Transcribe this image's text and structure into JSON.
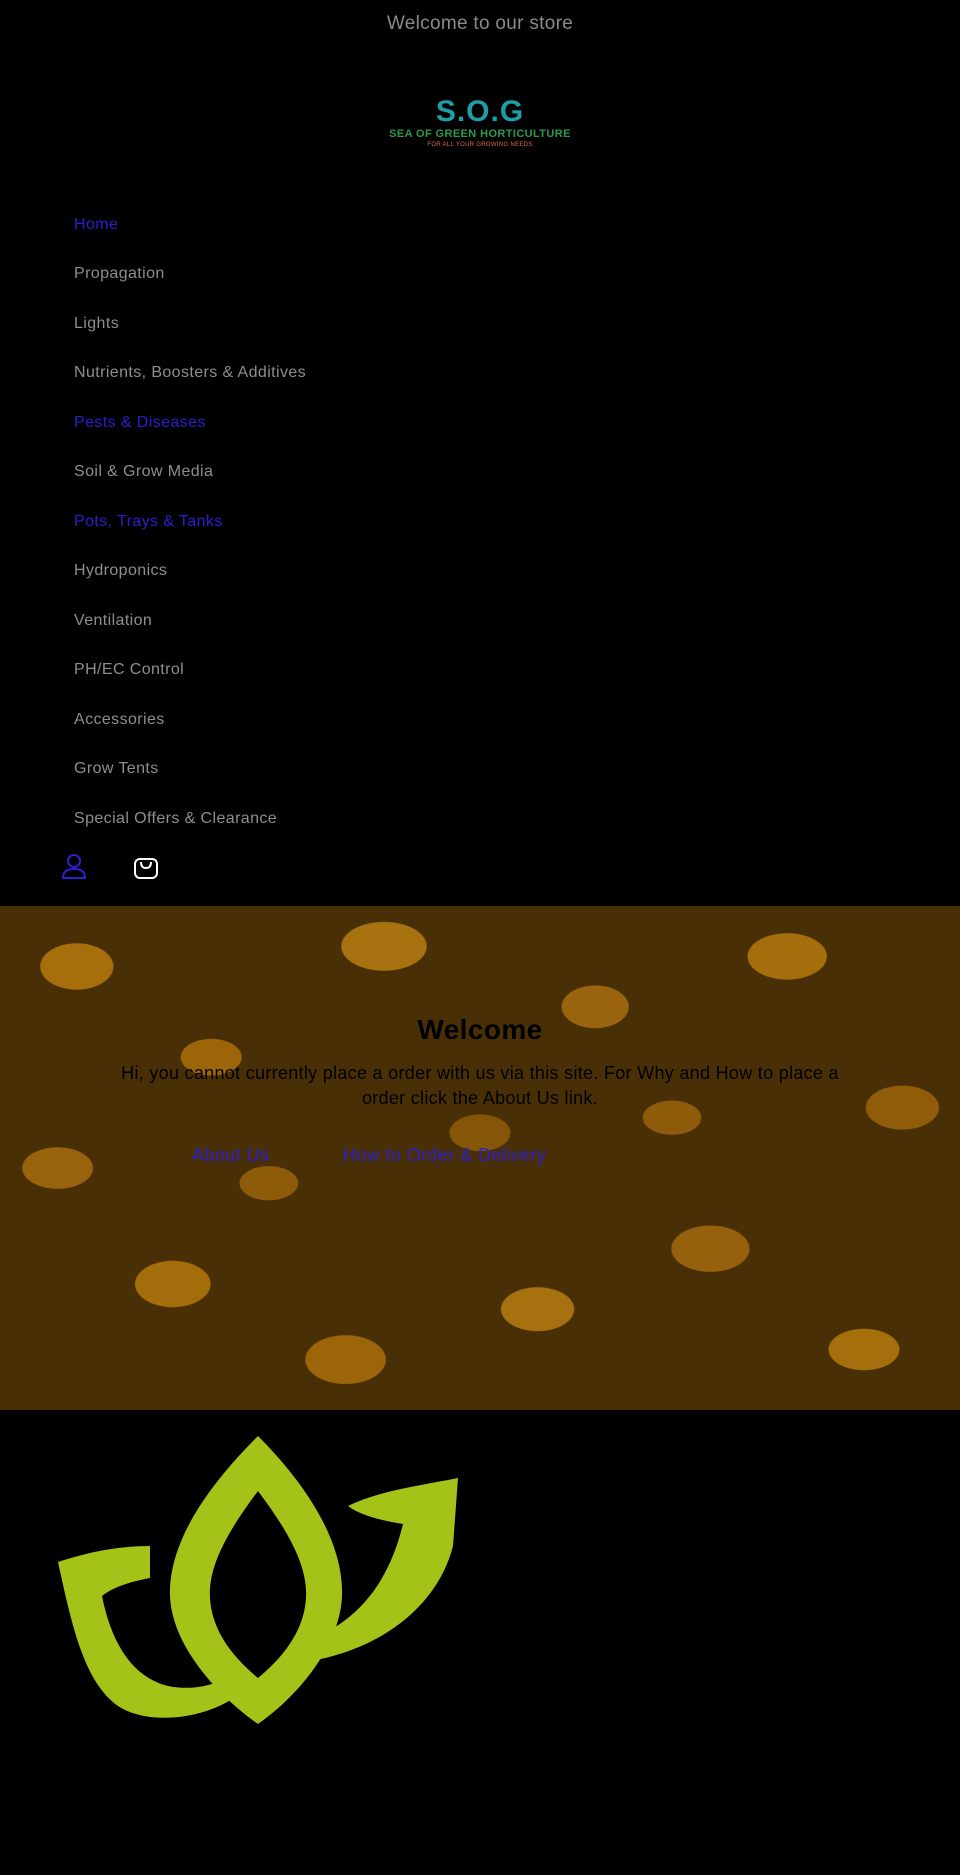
{
  "announcement": {
    "text": "Welcome to our store"
  },
  "logo": {
    "main": "S.O.G",
    "sub": "SEA OF GREEN HORTICULTURE",
    "tagline": "FOR ALL YOUR GROWING NEEDS"
  },
  "nav": {
    "items": [
      {
        "label": "Home"
      },
      {
        "label": "Propagation"
      },
      {
        "label": "Lights"
      },
      {
        "label": "Nutrients, Boosters & Additives"
      },
      {
        "label": "Pests & Diseases"
      },
      {
        "label": "Soil & Grow Media"
      },
      {
        "label": "Pots, Trays & Tanks"
      },
      {
        "label": "Hydroponics"
      },
      {
        "label": "Ventilation"
      },
      {
        "label": "PH/EC Control"
      },
      {
        "label": "Accessories"
      },
      {
        "label": "Grow Tents"
      },
      {
        "label": "Special Offers & Clearance"
      }
    ]
  },
  "icons": {
    "account": "user-icon",
    "cart": "shopping-bag-icon"
  },
  "hero": {
    "title": "Welcome",
    "text": "Hi, you cannot currently place a order with us via this site. For Why and How to place a order click the About Us link.",
    "buttons": {
      "about": "About Us",
      "delivery": "How to Order & Delivery"
    }
  },
  "colors": {
    "background": "#000000",
    "link": "#2b1fd0",
    "nav_text": "#8e8e8e",
    "leaf_green": "#a3c318",
    "hero_amber": "#c4850f"
  }
}
